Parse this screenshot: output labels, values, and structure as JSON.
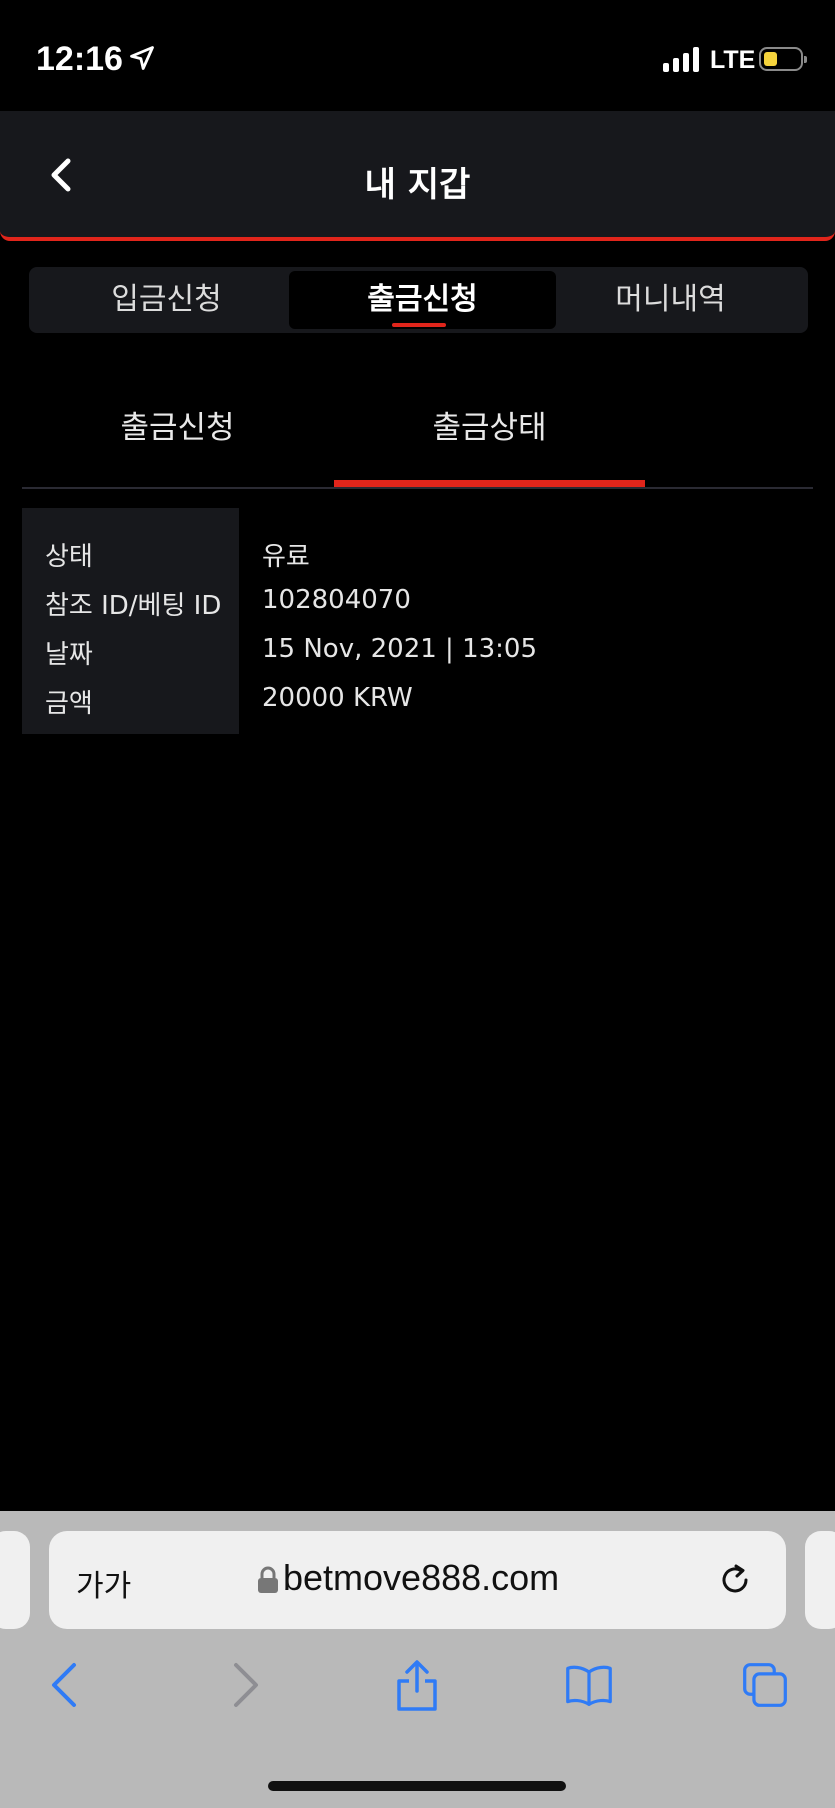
{
  "status_bar": {
    "time": "12:16",
    "network": "LTE"
  },
  "header": {
    "title": "내 지갑"
  },
  "tabs": [
    {
      "label": "입금신청"
    },
    {
      "label": "출금신청"
    },
    {
      "label": "머니내역"
    }
  ],
  "subtabs": [
    {
      "label": "출금신청"
    },
    {
      "label": "출금상태"
    }
  ],
  "details": [
    {
      "key": "상태",
      "value": "유료"
    },
    {
      "key": "참조 ID/베팅 ID",
      "value": "102804070"
    },
    {
      "key": "날짜",
      "value": "15 Nov, 2021 | 13:05"
    },
    {
      "key": "금액",
      "value": "20000 KRW"
    }
  ],
  "browser": {
    "text_size_label": "가가",
    "url": "betmove888.com"
  },
  "colors": {
    "accent": "#e1251b",
    "header_bg": "#17181c",
    "battery": "#f5d33c",
    "ios_blue": "#2f7bf6"
  }
}
